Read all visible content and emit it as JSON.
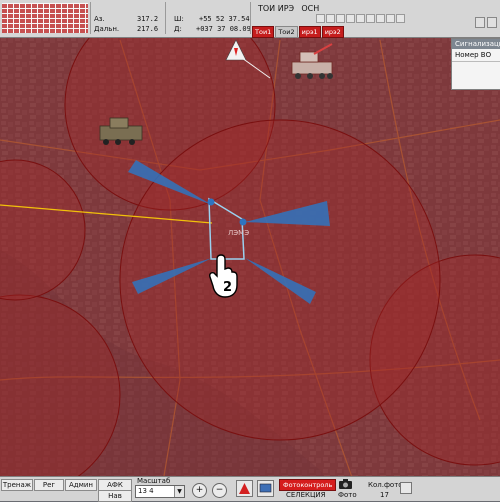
{
  "topbar": {
    "az_label": "Аз.",
    "az_value": "317.2",
    "dalnost_label": "Дальн.",
    "dalnost_value": "217.6",
    "lat_label": "Ш:",
    "lat_value": "+55 52 37.54",
    "lon_label": "Д:",
    "lon_value": "+037 37 08.09",
    "mode1": "ТОИ ИРЭ",
    "mode2": "ОСН",
    "toi_buttons": [
      "Тои1",
      "Тои2",
      "ирэ1",
      "ирэ2"
    ]
  },
  "signals_panel": {
    "title": "Сигнализация",
    "column": "Номер ВО"
  },
  "map": {
    "object_label": "ЛЭМЭ",
    "cursor_number": "2",
    "colors": {
      "zone_red": "#9b1c1c",
      "sector_blue": "#2f74c0",
      "track_yellow": "#f2c10a",
      "selection_box": "#9ad1f0"
    }
  },
  "bottombar": {
    "tabs": [
      "Тренаж",
      "Рег",
      "Админ",
      "АФК",
      "Нав"
    ],
    "scale_label": "Масштаб",
    "scale_value": "13 4",
    "zoom_in": "+",
    "zoom_out": "−",
    "fotocontrol_label": "Фотоконтроль",
    "selection_label": "СЕЛЕКЦИЯ",
    "foto_label": "Фото",
    "kol_foto_label": "Кол.фото",
    "kol_foto_value": "17"
  }
}
